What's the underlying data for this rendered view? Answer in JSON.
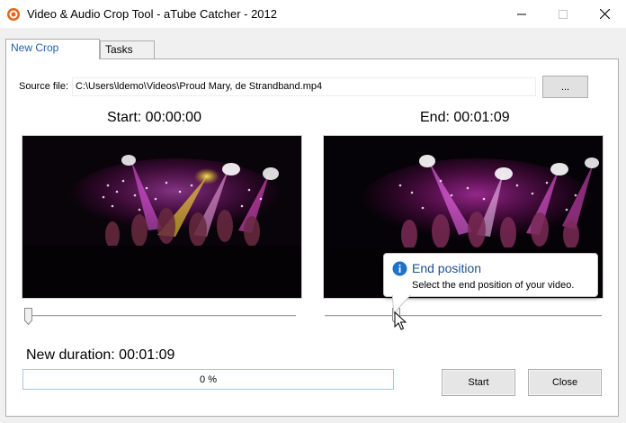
{
  "window": {
    "title": "Video & Audio Crop Tool - aTube Catcher - 2012",
    "icons": [
      "app-icon",
      "minimize-icon",
      "maximize-icon",
      "close-icon"
    ]
  },
  "tabs": [
    {
      "label": "New Crop",
      "active": true
    },
    {
      "label": "Tasks",
      "active": false
    }
  ],
  "source": {
    "label": "Source file:",
    "value": "C:\\Users\\ldemo\\Videos\\Proud Mary, de Strandband.mp4",
    "browse_label": "..."
  },
  "start": {
    "caption": "Start: 00:00:00",
    "slider_fraction": 0.0
  },
  "end": {
    "caption": "End: 00:01:09",
    "slider_fraction": 0.25
  },
  "duration": {
    "text": "New duration: 00:01:09"
  },
  "progress": {
    "percent": 0,
    "text": "0 %"
  },
  "buttons": {
    "start_label": "Start",
    "close_label": "Close"
  },
  "tooltip": {
    "title": "End position",
    "body": "Select the end position of your video.",
    "icon": "info-icon"
  },
  "colors": {
    "tab_active_text": "#2160b0",
    "tooltip_title": "#1e4f92",
    "info_icon": "#1e73c9",
    "progress_border": "#a6c8e8"
  }
}
